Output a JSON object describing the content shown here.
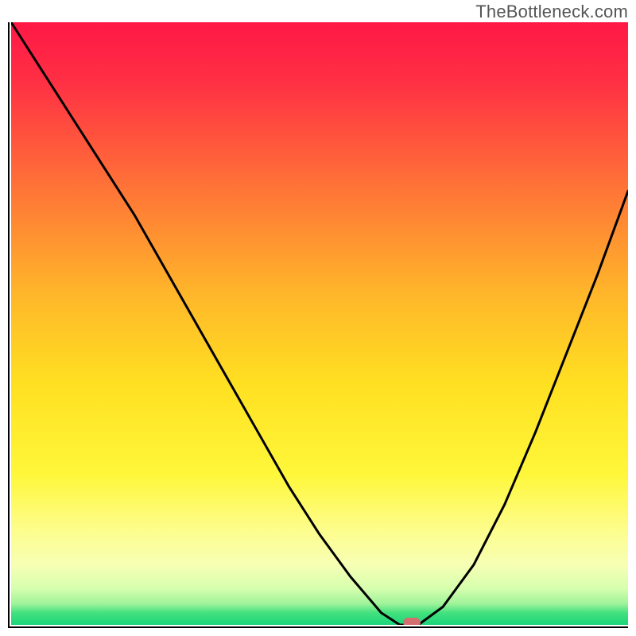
{
  "watermark": "TheBottleneck.com",
  "chart_data": {
    "type": "line",
    "x": [
      0,
      5,
      10,
      15,
      20,
      25,
      30,
      35,
      40,
      45,
      50,
      55,
      60,
      63,
      66,
      70,
      75,
      80,
      85,
      90,
      95,
      100
    ],
    "values": [
      100,
      92,
      84,
      76,
      68,
      59,
      50,
      41,
      32,
      23,
      15,
      8,
      2,
      0,
      0,
      3,
      10,
      20,
      32,
      45,
      58,
      72
    ],
    "title": "",
    "xlabel": "",
    "ylabel": "",
    "xlim": [
      0,
      100
    ],
    "ylim": [
      0,
      100
    ],
    "marker_x": 65,
    "marker_y": 0,
    "baseline_band": {
      "from": 0,
      "to": 3
    },
    "background_gradient": {
      "stops": [
        {
          "pct": 0,
          "color": "#ff1846"
        },
        {
          "pct": 10,
          "color": "#ff3044"
        },
        {
          "pct": 25,
          "color": "#ff6a39"
        },
        {
          "pct": 45,
          "color": "#ffb62a"
        },
        {
          "pct": 60,
          "color": "#ffe021"
        },
        {
          "pct": 75,
          "color": "#fff73a"
        },
        {
          "pct": 84,
          "color": "#fdfd8a"
        },
        {
          "pct": 90,
          "color": "#f7ffb4"
        },
        {
          "pct": 94,
          "color": "#d6ffae"
        },
        {
          "pct": 96.5,
          "color": "#9ff39a"
        },
        {
          "pct": 98,
          "color": "#43e17e"
        },
        {
          "pct": 100,
          "color": "#1bd57a"
        }
      ]
    }
  }
}
